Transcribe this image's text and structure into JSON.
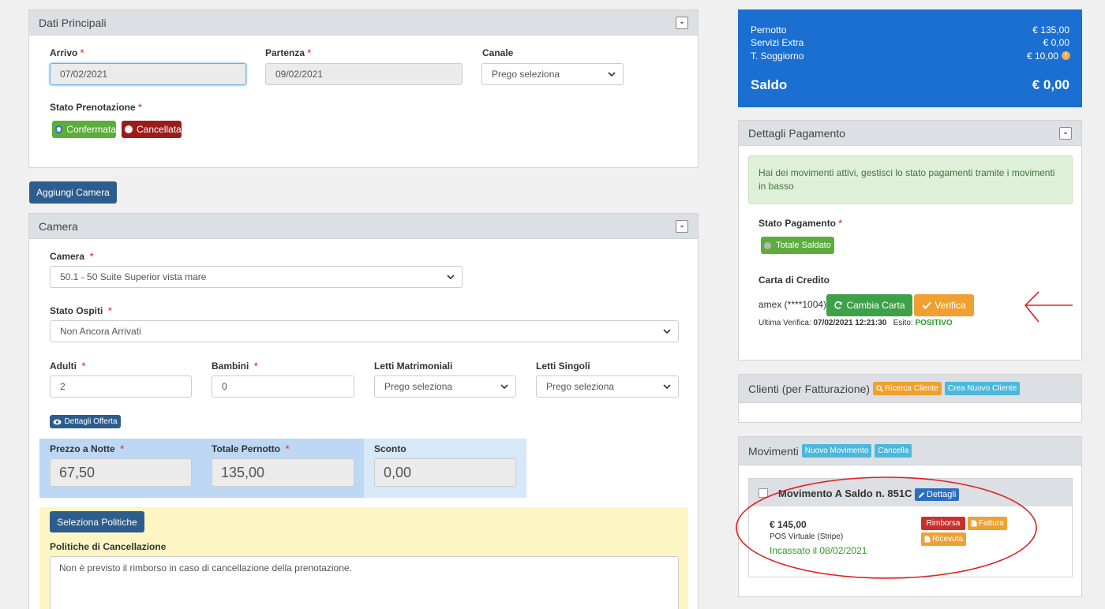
{
  "top_cut_text": "",
  "main": {
    "panel_dati": {
      "title": "Dati Principali",
      "collapse": "-",
      "arrivo_label": "Arrivo",
      "arrivo_value": "07/02/2021",
      "partenza_label": "Partenza",
      "partenza_value": "09/02/2021",
      "canale_label": "Canale",
      "canale_value": "Prego seleziona",
      "stato_label": "Stato Prenotazione",
      "confermata": "Confermata",
      "cancellata": "Cancellata"
    },
    "aggiungi_camera": "Aggiungi Camera",
    "panel_camera": {
      "title": "Camera",
      "collapse": "-",
      "camera_label": "Camera",
      "camera_value": "50.1 - 50 Suite Superior vista mare",
      "stato_ospiti_label": "Stato Ospiti",
      "stato_ospiti_value": "Non Ancora Arrivati",
      "adulti_label": "Adulti",
      "adulti_value": "2",
      "bambini_label": "Bambini",
      "bambini_value": "0",
      "letti_matr_label": "Letti Matrimoniali",
      "letti_matr_value": "Prego seleziona",
      "letti_sing_label": "Letti Singoli",
      "letti_sing_value": "Prego seleziona",
      "dettagli_offerta": "Dettagli Offerta",
      "prezzo_label": "Prezzo a Notte",
      "prezzo_value": "67,50",
      "totale_label": "Totale Pernotto",
      "totale_value": "135,00",
      "sconto_label": "Sconto",
      "sconto_value": "0,00",
      "seleziona_politiche": "Seleziona Politiche",
      "politiche_label": "Politiche di Cancellazione",
      "politiche_text": "Non è previsto il rimborso in caso di cancellazione della prenotazione."
    }
  },
  "summary": {
    "pernotto_label": "Pernotto",
    "pernotto_value": "€ 135,00",
    "servizi_label": "Servizi Extra",
    "servizi_value": "€ 0,00",
    "soggiorno_label": "T. Soggiorno",
    "soggiorno_value": "€ 10,00",
    "saldo_label": "Saldo",
    "saldo_value": "€ 0,00",
    "accent": "#1a6fd1"
  },
  "pagamento": {
    "title": "Dettagli Pagamento",
    "collapse": "-",
    "alert": "Hai dei movimenti attivi, gestisci lo stato pagamenti tramite i movimenti in basso",
    "stato_label": "Stato Pagamento",
    "stato_value": "Totale Saldato",
    "carta_label": "Carta di Credito",
    "carta_value": "amex (****1004)",
    "cambia_carta": "Cambia Carta",
    "verifica": "Verifica",
    "ultima_label": "Ultima Verifica:",
    "ultima_value": "07/02/2021 12:21:30",
    "esito_label": "Esito:",
    "esito_value": "POSITIVO"
  },
  "clienti": {
    "title": "Clienti (per Fatturazione)",
    "ricerca": "Ricerca Cliente",
    "crea": "Crea Nuovo Cliente"
  },
  "movimenti": {
    "title": "Movimenti",
    "nuovo": "Nuovo Movimento",
    "cancella": "Cancella",
    "item_title": "Movimento A Saldo n. 851C",
    "dettagli": "Dettagli",
    "amount": "€ 145,00",
    "method": "POS Virtuale (Stripe)",
    "incassato": "Incassato il 08/02/2021",
    "rimborsa": "Rimborsa",
    "fattura": "Fattura",
    "ricevuta": "Ricevuta"
  }
}
